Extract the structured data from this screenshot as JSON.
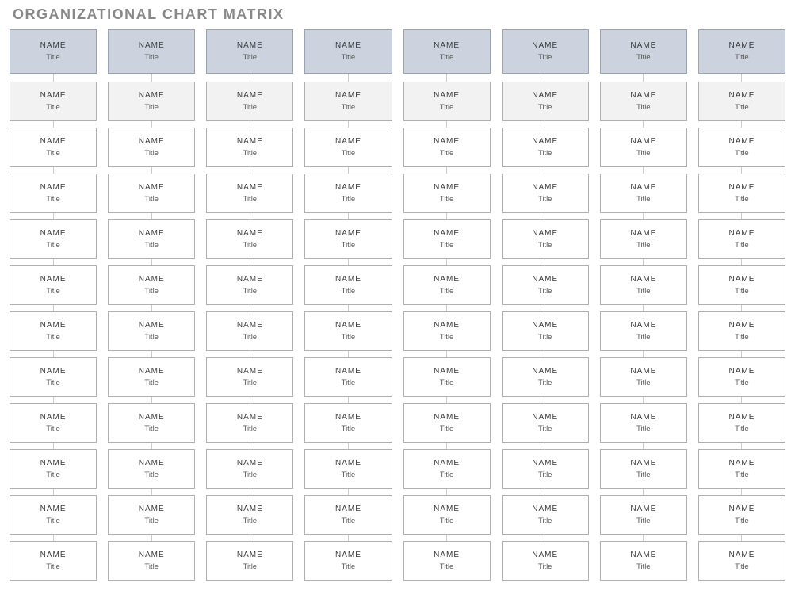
{
  "page_title": "ORGANIZATIONAL CHART MATRIX",
  "columns": 8,
  "rows": [
    {
      "type": "header",
      "cells": [
        {
          "name": "NAME",
          "title": "Title"
        },
        {
          "name": "NAME",
          "title": "Title"
        },
        {
          "name": "NAME",
          "title": "Title"
        },
        {
          "name": "NAME",
          "title": "Title"
        },
        {
          "name": "NAME",
          "title": "Title"
        },
        {
          "name": "NAME",
          "title": "Title"
        },
        {
          "name": "NAME",
          "title": "Title"
        },
        {
          "name": "NAME",
          "title": "Title"
        }
      ]
    },
    {
      "type": "sub",
      "cells": [
        {
          "name": "NAME",
          "title": "Title"
        },
        {
          "name": "NAME",
          "title": "Title"
        },
        {
          "name": "NAME",
          "title": "Title"
        },
        {
          "name": "NAME",
          "title": "Title"
        },
        {
          "name": "NAME",
          "title": "Title"
        },
        {
          "name": "NAME",
          "title": "Title"
        },
        {
          "name": "NAME",
          "title": "Title"
        },
        {
          "name": "NAME",
          "title": "Title"
        }
      ]
    },
    {
      "type": "node",
      "cells": [
        {
          "name": "NAME",
          "title": "Title"
        },
        {
          "name": "NAME",
          "title": "Title"
        },
        {
          "name": "NAME",
          "title": "Title"
        },
        {
          "name": "NAME",
          "title": "Title"
        },
        {
          "name": "NAME",
          "title": "Title"
        },
        {
          "name": "NAME",
          "title": "Title"
        },
        {
          "name": "NAME",
          "title": "Title"
        },
        {
          "name": "NAME",
          "title": "Title"
        }
      ]
    },
    {
      "type": "node",
      "cells": [
        {
          "name": "NAME",
          "title": "Title"
        },
        {
          "name": "NAME",
          "title": "Title"
        },
        {
          "name": "NAME",
          "title": "Title"
        },
        {
          "name": "NAME",
          "title": "Title"
        },
        {
          "name": "NAME",
          "title": "Title"
        },
        {
          "name": "NAME",
          "title": "Title"
        },
        {
          "name": "NAME",
          "title": "Title"
        },
        {
          "name": "NAME",
          "title": "Title"
        }
      ]
    },
    {
      "type": "node",
      "cells": [
        {
          "name": "NAME",
          "title": "Title"
        },
        {
          "name": "NAME",
          "title": "Title"
        },
        {
          "name": "NAME",
          "title": "Title"
        },
        {
          "name": "NAME",
          "title": "Title"
        },
        {
          "name": "NAME",
          "title": "Title"
        },
        {
          "name": "NAME",
          "title": "Title"
        },
        {
          "name": "NAME",
          "title": "Title"
        },
        {
          "name": "NAME",
          "title": "Title"
        }
      ]
    },
    {
      "type": "node",
      "cells": [
        {
          "name": "NAME",
          "title": "Title"
        },
        {
          "name": "NAME",
          "title": "Title"
        },
        {
          "name": "NAME",
          "title": "Title"
        },
        {
          "name": "NAME",
          "title": "Title"
        },
        {
          "name": "NAME",
          "title": "Title"
        },
        {
          "name": "NAME",
          "title": "Title"
        },
        {
          "name": "NAME",
          "title": "Title"
        },
        {
          "name": "NAME",
          "title": "Title"
        }
      ]
    },
    {
      "type": "node",
      "cells": [
        {
          "name": "NAME",
          "title": "Title"
        },
        {
          "name": "NAME",
          "title": "Title"
        },
        {
          "name": "NAME",
          "title": "Title"
        },
        {
          "name": "NAME",
          "title": "Title"
        },
        {
          "name": "NAME",
          "title": "Title"
        },
        {
          "name": "NAME",
          "title": "Title"
        },
        {
          "name": "NAME",
          "title": "Title"
        },
        {
          "name": "NAME",
          "title": "Title"
        }
      ]
    },
    {
      "type": "node",
      "cells": [
        {
          "name": "NAME",
          "title": "Title"
        },
        {
          "name": "NAME",
          "title": "Title"
        },
        {
          "name": "NAME",
          "title": "Title"
        },
        {
          "name": "NAME",
          "title": "Title"
        },
        {
          "name": "NAME",
          "title": "Title"
        },
        {
          "name": "NAME",
          "title": "Title"
        },
        {
          "name": "NAME",
          "title": "Title"
        },
        {
          "name": "NAME",
          "title": "Title"
        }
      ]
    },
    {
      "type": "node",
      "cells": [
        {
          "name": "NAME",
          "title": "Title"
        },
        {
          "name": "NAME",
          "title": "Title"
        },
        {
          "name": "NAME",
          "title": "Title"
        },
        {
          "name": "NAME",
          "title": "Title"
        },
        {
          "name": "NAME",
          "title": "Title"
        },
        {
          "name": "NAME",
          "title": "Title"
        },
        {
          "name": "NAME",
          "title": "Title"
        },
        {
          "name": "NAME",
          "title": "Title"
        }
      ]
    },
    {
      "type": "node",
      "cells": [
        {
          "name": "NAME",
          "title": "Title"
        },
        {
          "name": "NAME",
          "title": "Title"
        },
        {
          "name": "NAME",
          "title": "Title"
        },
        {
          "name": "NAME",
          "title": "Title"
        },
        {
          "name": "NAME",
          "title": "Title"
        },
        {
          "name": "NAME",
          "title": "Title"
        },
        {
          "name": "NAME",
          "title": "Title"
        },
        {
          "name": "NAME",
          "title": "Title"
        }
      ]
    },
    {
      "type": "node",
      "cells": [
        {
          "name": "NAME",
          "title": "Title"
        },
        {
          "name": "NAME",
          "title": "Title"
        },
        {
          "name": "NAME",
          "title": "Title"
        },
        {
          "name": "NAME",
          "title": "Title"
        },
        {
          "name": "NAME",
          "title": "Title"
        },
        {
          "name": "NAME",
          "title": "Title"
        },
        {
          "name": "NAME",
          "title": "Title"
        },
        {
          "name": "NAME",
          "title": "Title"
        }
      ]
    },
    {
      "type": "node",
      "cells": [
        {
          "name": "NAME",
          "title": "Title"
        },
        {
          "name": "NAME",
          "title": "Title"
        },
        {
          "name": "NAME",
          "title": "Title"
        },
        {
          "name": "NAME",
          "title": "Title"
        },
        {
          "name": "NAME",
          "title": "Title"
        },
        {
          "name": "NAME",
          "title": "Title"
        },
        {
          "name": "NAME",
          "title": "Title"
        },
        {
          "name": "NAME",
          "title": "Title"
        }
      ]
    }
  ]
}
